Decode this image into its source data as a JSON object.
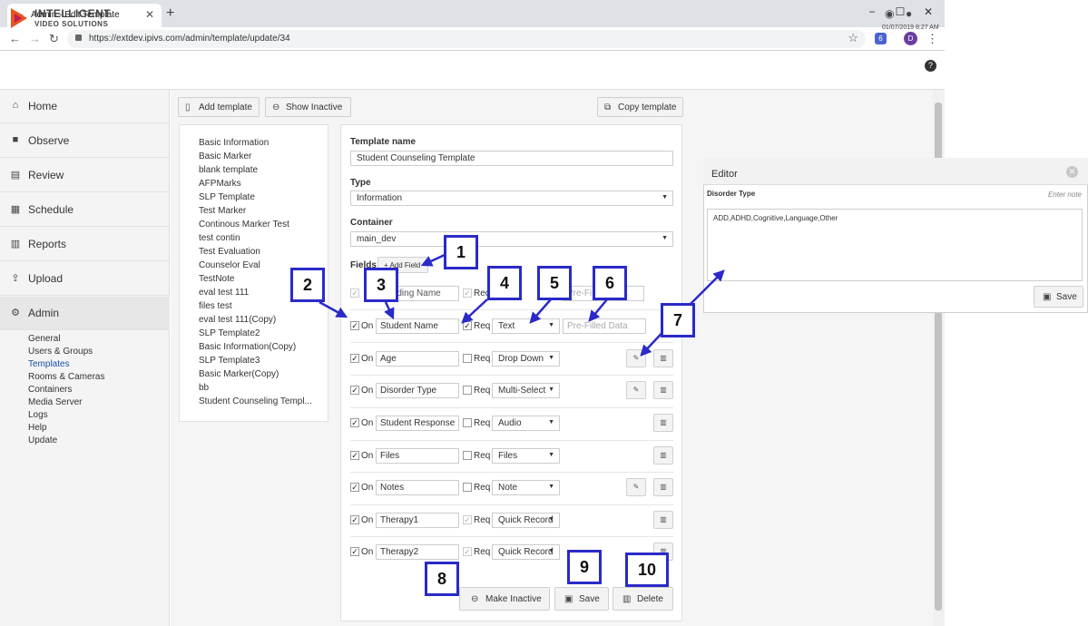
{
  "browser": {
    "tab_title": "Admin - Edit Template",
    "tab_close": "✕",
    "new_tab": "+",
    "url": "https://extdev.ipivs.com/admin/template/update/34",
    "profile_initial": "D",
    "extension_label": "6",
    "window_controls": [
      "−",
      "☐",
      "✕"
    ]
  },
  "header": {
    "logo_line1": "INTELLIGENT",
    "logo_line2": "VIDEO SOLUTIONS",
    "datetime": "01/07/2019 8:27 AM",
    "icons": [
      "eye-icon",
      "user-icon",
      "help-icon"
    ]
  },
  "sidebar": {
    "items": [
      {
        "label": "Home",
        "icon": "home-icon"
      },
      {
        "label": "Observe",
        "icon": "camera-icon"
      },
      {
        "label": "Review",
        "icon": "film-icon"
      },
      {
        "label": "Schedule",
        "icon": "calendar-icon"
      },
      {
        "label": "Reports",
        "icon": "bar-chart-icon"
      },
      {
        "label": "Upload",
        "icon": "upload-icon"
      },
      {
        "label": "Admin",
        "icon": "gear-icon"
      }
    ],
    "admin_sub": [
      "General",
      "Users & Groups",
      "Templates",
      "Rooms & Cameras",
      "Containers",
      "Media Server",
      "Logs",
      "Help",
      "Update"
    ]
  },
  "toolbar": {
    "add_template": "Add template",
    "show_inactive": "Show Inactive",
    "copy_template": "Copy template"
  },
  "templates": [
    "Basic Information",
    "Basic Marker",
    "blank template",
    "AFPMarks",
    "SLP Template",
    "Test Marker",
    "Continous Marker Test",
    "test contin",
    "Test Evaluation",
    "Counselor Eval",
    "TestNote",
    "eval test 111",
    "files test",
    "eval test 111(Copy)",
    "SLP Template2",
    "Basic Information(Copy)",
    "SLP Template3",
    "Basic Marker(Copy)",
    "bb",
    "Student Counseling Templ..."
  ],
  "form": {
    "template_name_label": "Template name",
    "template_name_value": "Student Counseling Template",
    "type_label": "Type",
    "type_value": "Information",
    "container_label": "Container",
    "container_value": "main_dev",
    "fields_label": "Fields",
    "add_field": "+ Add Field",
    "on_label": "On",
    "req_label": "Req",
    "prefill_placeholder": "Pre-Filled Data",
    "fields": [
      {
        "name": "Reading Name",
        "type": "",
        "on": true,
        "req": true
      },
      {
        "name": "Student Name",
        "type": "Text",
        "on": true,
        "req": true,
        "prefill": "Pre-Filled Data"
      },
      {
        "name": "Age",
        "type": "Drop Down",
        "on": true,
        "req": false
      },
      {
        "name": "Disorder Type",
        "type": "Multi-Select",
        "on": true,
        "req": false
      },
      {
        "name": "Student Response",
        "type": "Audio",
        "on": true,
        "req": false
      },
      {
        "name": "Files",
        "type": "Files",
        "on": true,
        "req": false
      },
      {
        "name": "Notes",
        "type": "Note",
        "on": true,
        "req": false
      },
      {
        "name": "Therapy1",
        "type": "Quick Record",
        "on": true,
        "req": true
      },
      {
        "name": "Therapy2",
        "type": "Quick Record",
        "on": true,
        "req": true
      }
    ],
    "make_inactive": "Make Inactive",
    "save": "Save",
    "delete": "Delete"
  },
  "editor": {
    "title": "Editor",
    "field_label": "Disorder Type",
    "hint": "Enter note",
    "content": "ADD,ADHD,Cognitive,Language,Other",
    "save": "Save"
  },
  "callouts": [
    "1",
    "2",
    "3",
    "4",
    "5",
    "6",
    "7",
    "8",
    "9",
    "10"
  ],
  "colors": {
    "accent": "#2a2ac8",
    "brand_orange": "#e8541e",
    "link_blue": "#1a4fa8"
  }
}
